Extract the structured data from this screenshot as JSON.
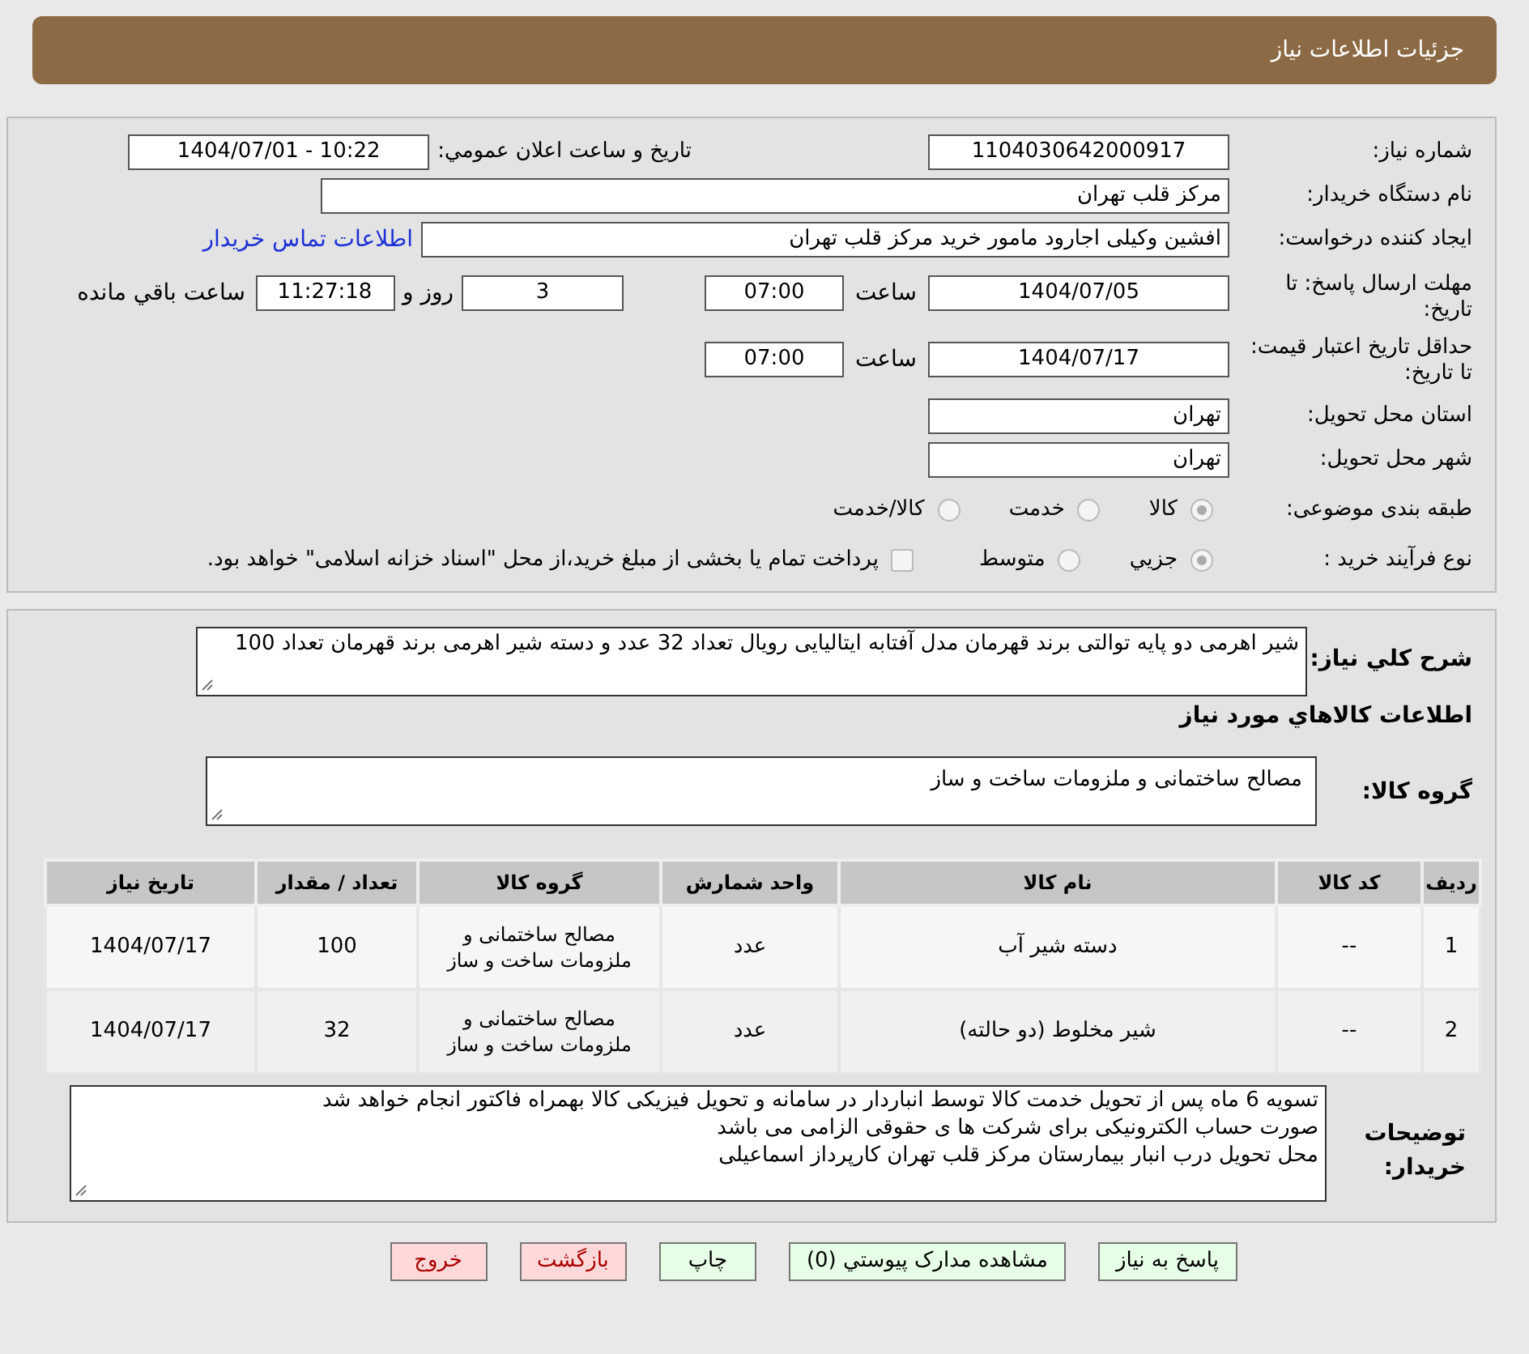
{
  "header": {
    "title": "جزئیات اطلاعات نیاز"
  },
  "need_number": {
    "label": "شماره نیاز:",
    "value": "1104030642000917"
  },
  "announce": {
    "label": "تاریخ و ساعت اعلان عمومي:",
    "value": "1404/07/01 - 10:22"
  },
  "buyer": {
    "label": "نام دستگاه خریدار:",
    "value": "مرکز قلب تهران"
  },
  "creator": {
    "label": "ایجاد کننده درخواست:",
    "value": "افشین وکیلی اجارود مامور خرید مرکز قلب تهران",
    "link": "اطلاعات تماس خریدار"
  },
  "deadline": {
    "label": "مهلت ارسال پاسخ: تا تاریخ:",
    "date": "1404/07/05",
    "time_label": "ساعت",
    "time": "07:00",
    "days": "3",
    "days_label": "روز و",
    "remaining": "11:27:18",
    "remaining_label": "ساعت باقي مانده"
  },
  "validity": {
    "label": "حداقل تاریخ اعتبار قیمت: تا تاریخ:",
    "date": "1404/07/17",
    "time_label": "ساعت",
    "time": "07:00"
  },
  "province": {
    "label": "استان محل تحویل:",
    "value": "تهران"
  },
  "city": {
    "label": "شهر محل تحویل:",
    "value": "تهران"
  },
  "category": {
    "label": "طبقه بندی موضوعی:",
    "options": [
      {
        "label": "کالا",
        "selected": true
      },
      {
        "label": "خدمت",
        "selected": false
      },
      {
        "label": "کالا/خدمت",
        "selected": false
      }
    ]
  },
  "process": {
    "label": "نوع فرآیند خرید :",
    "options": [
      {
        "label": "جزيي",
        "selected": true
      },
      {
        "label": "متوسط",
        "selected": false
      }
    ],
    "checkbox": {
      "label": "پرداخت تمام یا بخشی از مبلغ خرید،از محل \"اسناد خزانه اسلامی\" خواهد بود.",
      "checked": false
    }
  },
  "description": {
    "label": "شرح کلي نیاز:",
    "value": "شیر اهرمی دو پایه توالتی برند قهرمان مدل آفتابه ایتالیایی رویال تعداد 32 عدد و دسته شیر اهرمی برند قهرمان تعداد 100"
  },
  "goods_heading": "اطلاعات کالاهاي مورد نیاز",
  "goods_group": {
    "label": "گروه کالا:",
    "value": "مصالح ساختمانی و ملزومات ساخت و ساز"
  },
  "table": {
    "columns": [
      "ردیف",
      "کد کالا",
      "نام کالا",
      "واحد شمارش",
      "گروه کالا",
      "تعداد / مقدار",
      "تاریخ نیاز"
    ],
    "rows": [
      [
        "1",
        "--",
        "دسته شیر آب",
        "عدد",
        "مصالح ساختمانی و ملزومات ساخت و ساز",
        "100",
        "1404/07/17"
      ],
      [
        "2",
        "--",
        "شیر مخلوط (دو حالته)",
        "عدد",
        "مصالح ساختمانی و ملزومات ساخت و ساز",
        "32",
        "1404/07/17"
      ]
    ]
  },
  "notes": {
    "label": "توضیحات خریدار:",
    "lines": [
      "تسویه 6 ماه پس از تحویل خدمت کالا توسط انباردار در سامانه و تحویل فیزیکی کالا بهمراه فاکتور انجام خواهد شد",
      "صورت حساب الکترونیکی برای شرکت ها ی حقوقی الزامی می باشد",
      "محل تحویل درب انبار بیمارستان مرکز قلب تهران کارپرداز اسماعیلی"
    ]
  },
  "buttons": [
    {
      "label": "پاسخ به نیاز",
      "kind": "green"
    },
    {
      "label": "مشاهده مدارک پیوستي (0)",
      "kind": "green"
    },
    {
      "label": "چاپ",
      "kind": "green"
    },
    {
      "label": "بازگشت",
      "kind": "red"
    },
    {
      "label": "خروج",
      "kind": "red"
    }
  ]
}
